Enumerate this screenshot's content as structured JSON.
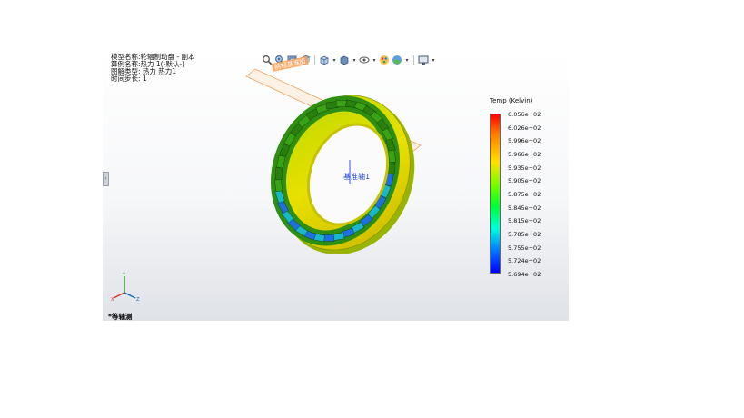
{
  "info": {
    "model_name": "模型名称:轮辐制动盘 - 副本",
    "study_name": "算例名称:热力 1(-默认-)",
    "plot_type": "图解类型: 热力 热力1",
    "time_step": "时间步长: 1"
  },
  "toolbar": {
    "icons": [
      "zoom-to-fit-icon",
      "zoom-area-icon",
      "previous-view-icon",
      "section-view-icon",
      "view-orientation-icon",
      "display-style-icon",
      "hide-show-items-icon",
      "edit-appearance-icon",
      "apply-scene-icon",
      "view-settings-icon"
    ]
  },
  "viewport": {
    "plane_label": "前视基准面",
    "axis_label": "基准轴1",
    "view_name": "*等轴测"
  },
  "legend": {
    "title": "Temp (Kelvin)",
    "ticks": [
      "6.056e+02",
      "6.026e+02",
      "5.996e+02",
      "5.966e+02",
      "5.935e+02",
      "5.905e+02",
      "5.875e+02",
      "5.845e+02",
      "5.815e+02",
      "5.785e+02",
      "5.755e+02",
      "5.724e+02",
      "5.694e+02"
    ],
    "colors": [
      "#ff0000",
      "#ff7a00",
      "#ffe100",
      "#6cff00",
      "#00ff36",
      "#00ffd8",
      "#0077ff",
      "#0000ff"
    ]
  }
}
